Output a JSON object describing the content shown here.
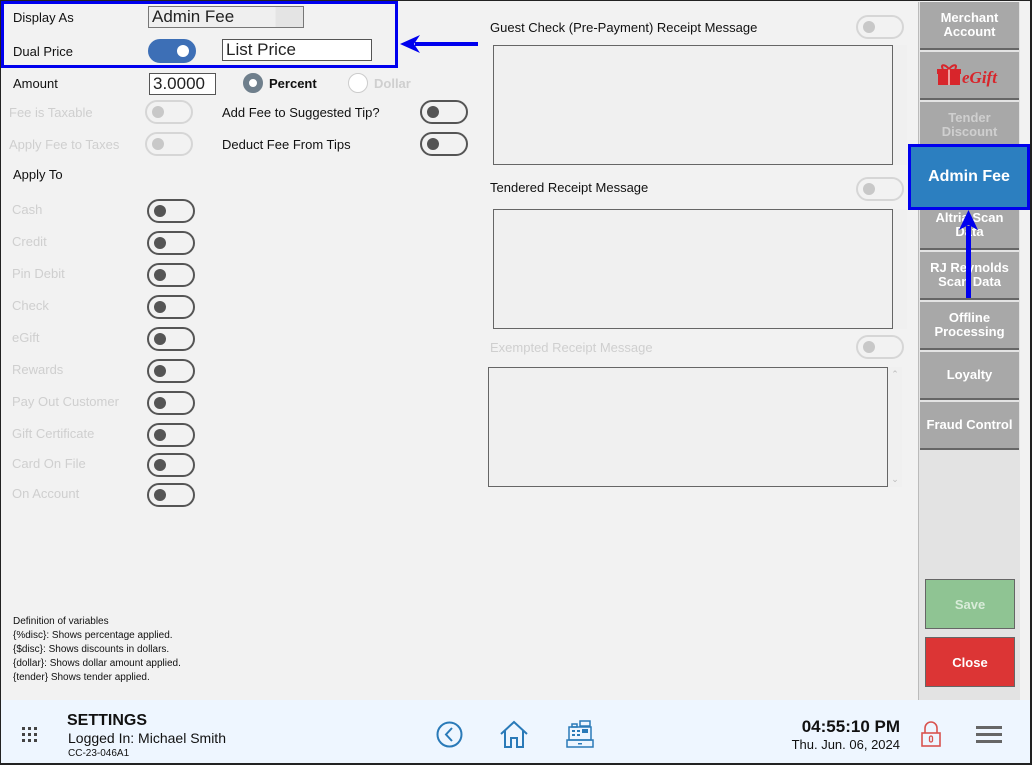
{
  "form": {
    "display_as": {
      "label": "Display As",
      "value": "Admin Fee"
    },
    "dual_price": {
      "label": "Dual Price",
      "enabled": true,
      "value": "List Price"
    },
    "amount": {
      "label": "Amount",
      "value": "3.0000"
    },
    "amount_type": {
      "options": [
        "Percent",
        "Dollar"
      ],
      "selected": "Percent"
    },
    "fee_is_taxable": {
      "label": "Fee is Taxable",
      "enabled": false,
      "disabled": true
    },
    "apply_fee_to_taxes": {
      "label": "Apply Fee to Taxes",
      "enabled": false,
      "disabled": true
    },
    "add_fee_to_tip": {
      "label": "Add Fee to Suggested Tip?",
      "enabled": false
    },
    "deduct_fee_from_tips": {
      "label": "Deduct Fee From Tips",
      "enabled": false
    },
    "apply_to": {
      "label": "Apply To",
      "items": [
        {
          "label": "Cash",
          "enabled": false
        },
        {
          "label": "Credit",
          "enabled": false
        },
        {
          "label": "Pin Debit",
          "enabled": false
        },
        {
          "label": "Check",
          "enabled": false
        },
        {
          "label": "eGift",
          "enabled": false
        },
        {
          "label": "Rewards",
          "enabled": false
        },
        {
          "label": "Pay Out Customer",
          "enabled": false
        },
        {
          "label": "Gift Certificate",
          "enabled": false
        },
        {
          "label": "Card On File",
          "enabled": false
        },
        {
          "label": "On Account",
          "enabled": false
        }
      ]
    }
  },
  "messages": {
    "guest_check": {
      "label": "Guest Check (Pre-Payment) Receipt Message",
      "enabled": false,
      "value": ""
    },
    "tendered": {
      "label": "Tendered Receipt Message",
      "enabled": false,
      "value": ""
    },
    "exempted": {
      "label": "Exempted Receipt Message",
      "enabled": false,
      "value": "",
      "disabled": true
    }
  },
  "definitions": {
    "title": "Definition of variables",
    "lines": [
      "{%disc}: Shows percentage applied.",
      "{$disc}:  Shows discounts in dollars.",
      "{dollar}: Shows dollar amount applied.",
      "{tender} Shows tender applied."
    ]
  },
  "sidenav": {
    "items": [
      {
        "label": "Merchant Account"
      },
      {
        "label": "eGift",
        "icon": "egift-logo"
      },
      {
        "label": "Tender Discount",
        "dim": true
      },
      {
        "label": "Admin Fee",
        "active": true
      },
      {
        "label": "Altria Scan Data"
      },
      {
        "label": "RJ Reynolds Scan Data"
      },
      {
        "label": "Offline Processing"
      },
      {
        "label": "Loyalty"
      },
      {
        "label": "Fraud Control"
      }
    ],
    "save_label": "Save",
    "close_label": "Close"
  },
  "footer": {
    "title": "SETTINGS",
    "logged_in": "Logged In:  Michael Smith",
    "station_code": "CC-23-046A1",
    "time": "04:55:10 PM",
    "date": "Thu. Jun. 06, 2024"
  },
  "colors": {
    "accent": "#2c7fc0",
    "highlight": "#0000ee",
    "toggle_on": "#3d6fb6",
    "save": "#8fc493",
    "close": "#dc3535",
    "egift_red": "#d8252b",
    "footer_icons": "#2a7ab8",
    "lock": "#d9534f"
  }
}
